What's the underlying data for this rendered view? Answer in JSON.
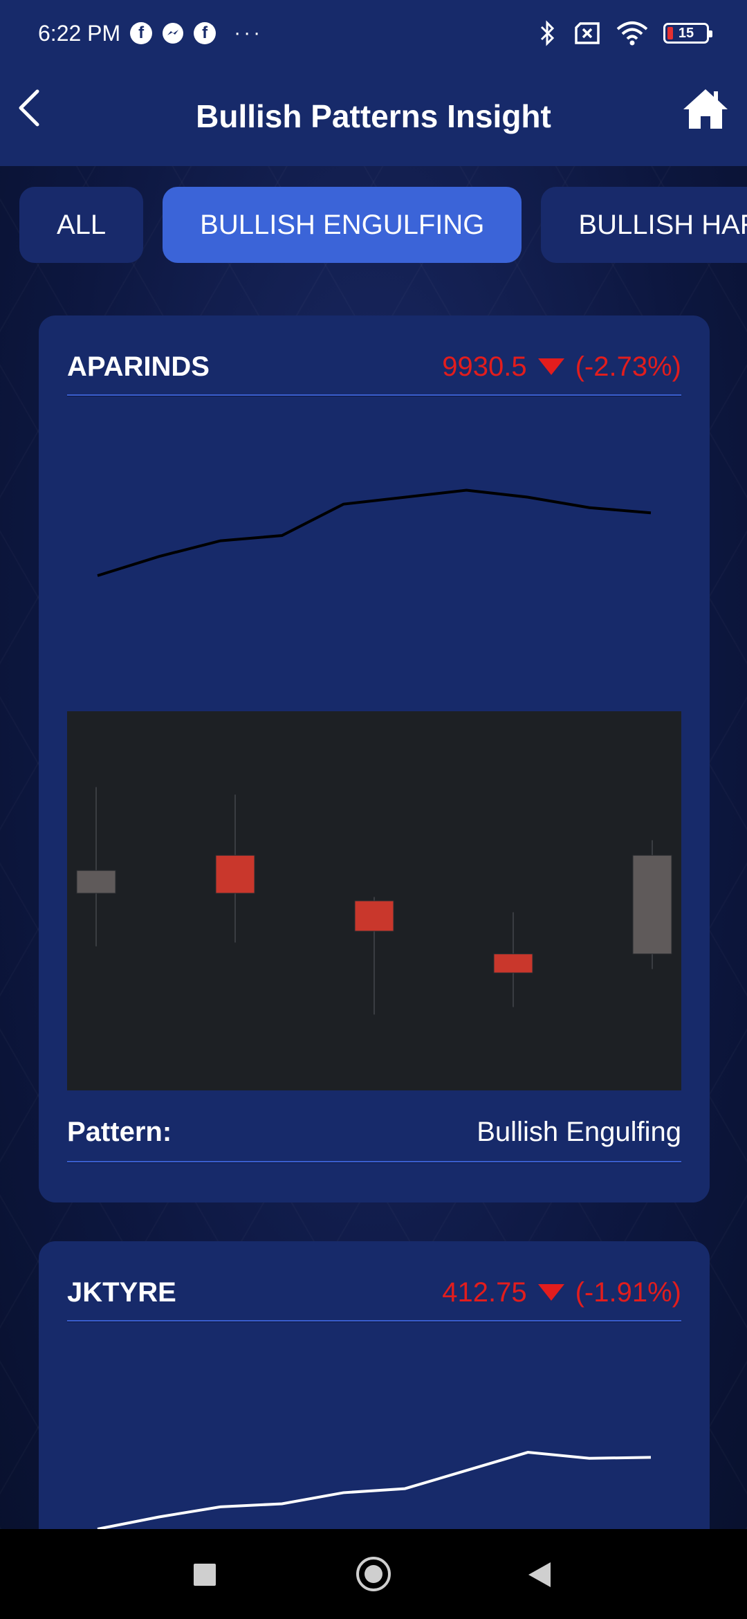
{
  "status_bar": {
    "time": "6:22 PM",
    "app_icons": [
      "facebook-icon",
      "messenger-icon",
      "facebook-icon"
    ],
    "more": "···",
    "right_icons": [
      "bluetooth-icon",
      "no-sim-icon",
      "wifi-icon",
      "battery-icon"
    ],
    "battery_level": "15"
  },
  "app_bar": {
    "title": "Bullish Patterns Insight",
    "back_icon": "chevron-left-icon",
    "home_icon": "home-icon"
  },
  "tabs": [
    {
      "label": "ALL",
      "active": false
    },
    {
      "label": "BULLISH ENGULFING",
      "active": true
    },
    {
      "label": "BULLISH HARAMI",
      "active": false
    }
  ],
  "colors": {
    "primary_bg": "#172a6a",
    "active_tab": "#3b64d8",
    "price_down": "#e21d1d",
    "bearish_candle": "#c9372c",
    "bullish_candle": "#5f5a5a",
    "candle_panel_bg": "#1d2024"
  },
  "stocks": [
    {
      "symbol": "APARINDS",
      "price": "9930.5",
      "change": "(-2.73%)",
      "direction": "down",
      "pattern_label": "Pattern:",
      "pattern_value": "Bullish Engulfing",
      "chart_data": {
        "type": "line",
        "series": [
          {
            "values": [
              0,
              0.22,
              0.4,
              0.46,
              0.82,
              0.9,
              0.98,
              0.9,
              0.78,
              0.72
            ]
          }
        ],
        "line_color": "#000000"
      },
      "candle_data": {
        "type": "candlestick",
        "candles": [
          {
            "open": 0.58,
            "close": 0.52,
            "high": 0.8,
            "low": 0.38,
            "color": "gray"
          },
          {
            "open": 0.62,
            "close": 0.52,
            "high": 0.78,
            "low": 0.39,
            "color": "red"
          },
          {
            "open": 0.5,
            "close": 0.42,
            "high": 0.51,
            "low": 0.2,
            "color": "red"
          },
          {
            "open": 0.36,
            "close": 0.31,
            "high": 0.47,
            "low": 0.22,
            "color": "red"
          },
          {
            "open": 0.36,
            "close": 0.62,
            "high": 0.66,
            "low": 0.32,
            "color": "gray"
          }
        ]
      }
    },
    {
      "symbol": "JKTYRE",
      "price": "412.75",
      "change": "(-1.91%)",
      "direction": "down",
      "chart_data": {
        "type": "line",
        "series": [
          {
            "values": [
              0,
              0.12,
              0.22,
              0.25,
              0.36,
              0.4,
              0.58,
              0.76,
              0.7,
              0.71
            ]
          }
        ],
        "line_color": "#ffffff"
      }
    }
  ]
}
